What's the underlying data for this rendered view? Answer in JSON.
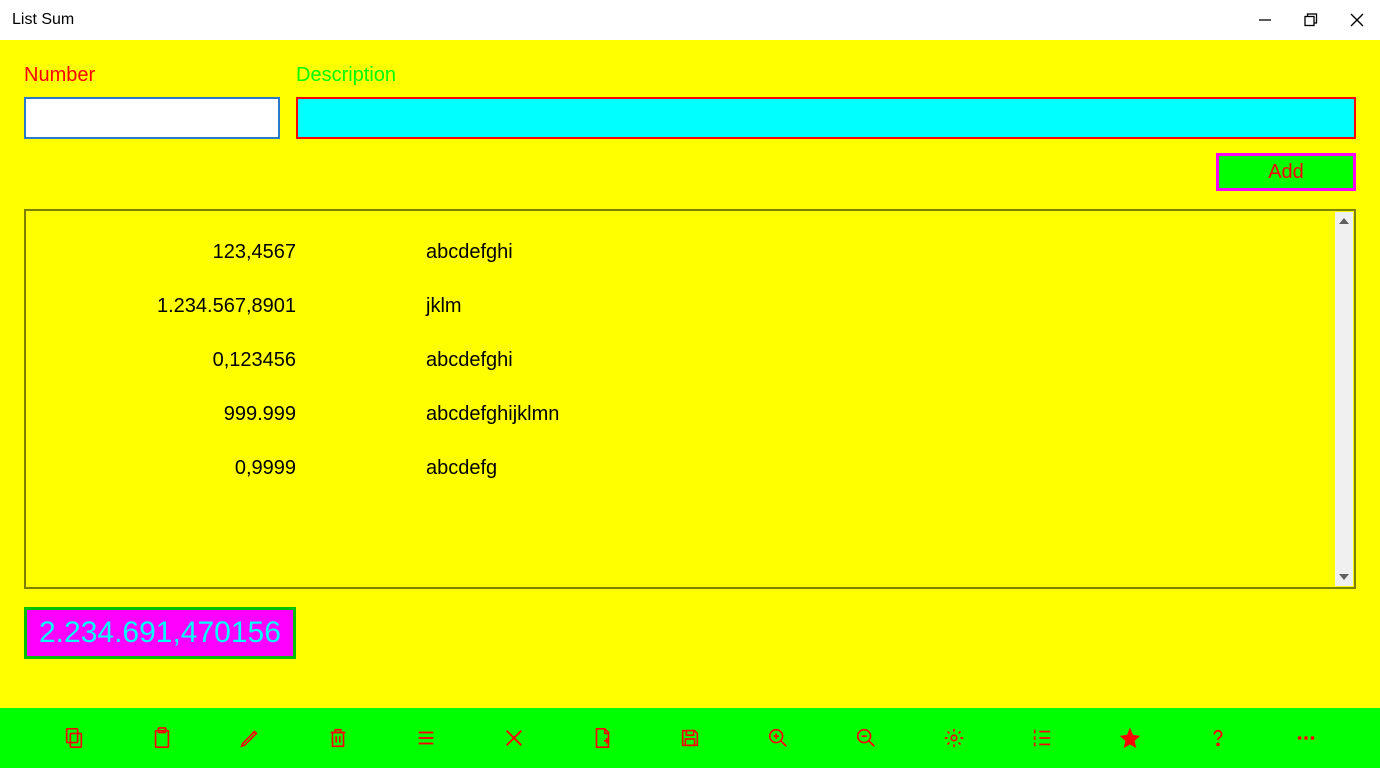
{
  "window": {
    "title": "List Sum"
  },
  "labels": {
    "number": "Number",
    "description": "Description"
  },
  "inputs": {
    "number_value": "",
    "number_placeholder": "",
    "description_value": "",
    "description_placeholder": ""
  },
  "buttons": {
    "add": "Add"
  },
  "list": {
    "items": [
      {
        "number": "123,4567",
        "description": "abcdefghi"
      },
      {
        "number": "1.234.567,8901",
        "description": "jklm"
      },
      {
        "number": "0,123456",
        "description": "abcdefghi"
      },
      {
        "number": "999.999",
        "description": "abcdefghijklmn"
      },
      {
        "number": "0,9999",
        "description": "abcdefg"
      }
    ]
  },
  "sum": "2.234.691,470156",
  "colors": {
    "bg": "#ffff00",
    "accent_green": "#00ff00",
    "accent_red": "#ff0000",
    "accent_cyan": "#00ffff",
    "accent_magenta": "#ff00ff",
    "border_olive": "#808000"
  },
  "toolbar_icons": [
    "copy-icon",
    "paste-icon",
    "edit-icon",
    "delete-icon",
    "list-icon",
    "close-icon",
    "new-file-icon",
    "save-icon",
    "zoom-in-icon",
    "zoom-out-icon",
    "settings-icon",
    "numbered-list-icon",
    "favorite-icon",
    "help-icon",
    "more-icon"
  ]
}
